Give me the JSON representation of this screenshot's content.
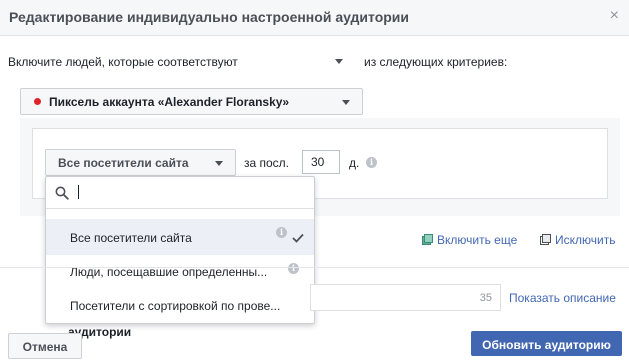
{
  "dialog": {
    "title": "Редактирование индивидуально настроенной аудитории",
    "close_icon": "×"
  },
  "rule": {
    "include_label": "Включите людей, которые соответствуют",
    "criteria_label": "из следующих критериев:",
    "pixel_label": "Пиксель аккаунта «Alexander Floransky»",
    "pixel_status_color": "#e0242c",
    "visitors_label": "Все посетители сайта",
    "last_label": "за посл.",
    "days_value": "30",
    "days_unit": "д."
  },
  "dropdown": {
    "search_value": "",
    "items": [
      {
        "label": "Все посетители сайта",
        "selected": true
      },
      {
        "label": "Люди, посещавшие определенны...",
        "selected": false
      },
      {
        "label": "Посетители с сортировкой по прове...",
        "selected": false
      }
    ]
  },
  "links": {
    "include_more": "Включить еще",
    "exclude": "Исключить"
  },
  "name_section": {
    "char_count": "35",
    "show_description": "Показать описание",
    "audience_label": "аудитории"
  },
  "footer": {
    "cancel": "Отмена",
    "update": "Обновить аудиторию"
  },
  "colors": {
    "primary": "#4267b2",
    "link": "#4267b2"
  }
}
